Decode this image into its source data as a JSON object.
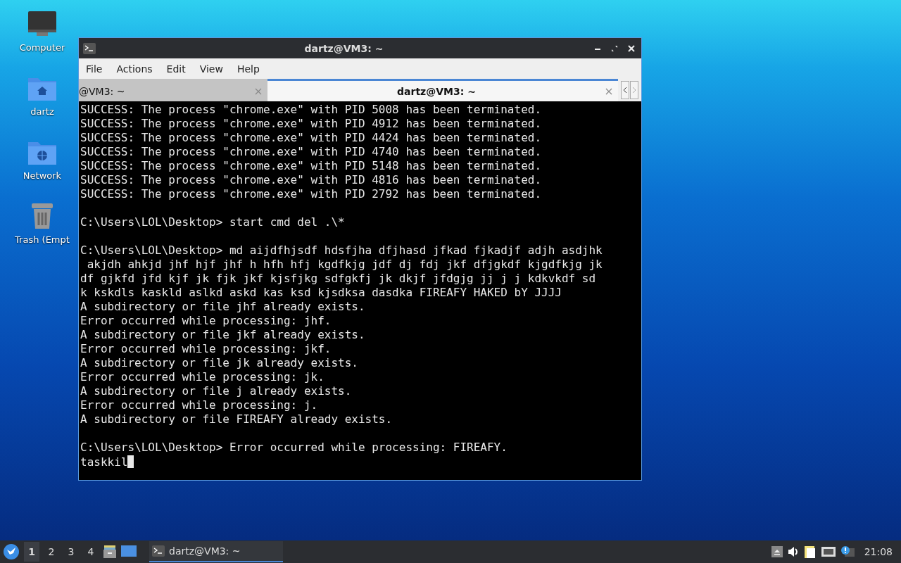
{
  "desktop_icons": [
    {
      "label": "Computer",
      "kind": "computer"
    },
    {
      "label": "dartz",
      "kind": "home"
    },
    {
      "label": "Network",
      "kind": "network"
    },
    {
      "label": "Trash (Empt",
      "kind": "trash"
    }
  ],
  "window": {
    "title": "dartz@VM3: ~",
    "menu": [
      "File",
      "Actions",
      "Edit",
      "View",
      "Help"
    ],
    "tabs": [
      {
        "label": "@VM3: ~",
        "selected": false
      },
      {
        "label": "dartz@VM3: ~",
        "selected": true
      }
    ],
    "terminal": {
      "blocks": [
        [
          "SUCCESS: The process \"chrome.exe\" with PID 5008 has been terminated.",
          "SUCCESS: The process \"chrome.exe\" with PID 4912 has been terminated.",
          "SUCCESS: The process \"chrome.exe\" with PID 4424 has been terminated.",
          "SUCCESS: The process \"chrome.exe\" with PID 4740 has been terminated.",
          "SUCCESS: The process \"chrome.exe\" with PID 5148 has been terminated.",
          "SUCCESS: The process \"chrome.exe\" with PID 4816 has been terminated.",
          "SUCCESS: The process \"chrome.exe\" with PID 2792 has been terminated."
        ],
        [
          "C:\\Users\\LOL\\Desktop> start cmd del .\\*"
        ],
        [
          "C:\\Users\\LOL\\Desktop> md aijdfhjsdf hdsfjha dfjhasd jfkad fjkadjf adjh asdjhk",
          " akjdh ahkjd jhf hjf jhf h hfh hfj kgdfkjg jdf dj fdj jkf dfjgkdf kjgdfkjg jk",
          "df gjkfd jfd kjf jk fjk jkf kjsfjkg sdfgkfj jk dkjf jfdgjg jj j j kdkvkdf sd",
          "k kskdls kaskld aslkd askd kas ksd kjsdksa dasdka FIREAFY HAKED bY JJJJ",
          "A subdirectory or file jhf already exists.",
          "Error occurred while processing: jhf.",
          "A subdirectory or file jkf already exists.",
          "Error occurred while processing: jkf.",
          "A subdirectory or file jk already exists.",
          "Error occurred while processing: jk.",
          "A subdirectory or file j already exists.",
          "Error occurred while processing: j.",
          "A subdirectory or file FIREAFY already exists."
        ],
        [
          "C:\\Users\\LOL\\Desktop> Error occurred while processing: FIREAFY."
        ]
      ],
      "input": "taskkil"
    }
  },
  "taskbar": {
    "workspaces": [
      {
        "label": "1",
        "selected": true
      },
      {
        "label": "2",
        "selected": false
      },
      {
        "label": "3",
        "selected": false
      },
      {
        "label": "4",
        "selected": false
      }
    ],
    "tasks": [
      {
        "label": "dartz@VM3: ~",
        "selected": true
      }
    ],
    "clock": "21:08"
  }
}
